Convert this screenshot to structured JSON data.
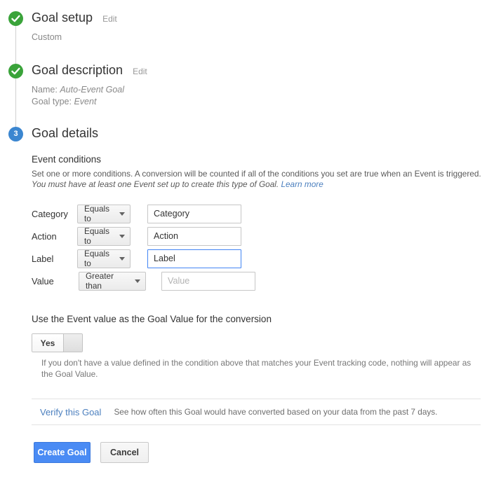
{
  "steps": [
    {
      "marker": "check-icon",
      "state": "done",
      "title": "Goal setup",
      "edit_label": "Edit",
      "summary": "Custom"
    },
    {
      "marker": "check-icon",
      "state": "done",
      "title": "Goal description",
      "edit_label": "Edit",
      "name_label": "Name:",
      "name_value": "Auto-Event Goal",
      "type_label": "Goal type:",
      "type_value": "Event"
    },
    {
      "marker": "3",
      "state": "active",
      "title": "Goal details"
    }
  ],
  "details": {
    "section_title": "Event conditions",
    "desc_line1": "Set one or more conditions. A conversion will be counted if all of the conditions you set are true when an Event is triggered.",
    "desc_line2": "You must have at least one Event set up to create this type of Goal.",
    "learn_more": "Learn more",
    "conditions": [
      {
        "label": "Category",
        "operator": "Equals to",
        "value": "Category",
        "placeholder": "Category",
        "filled": true,
        "focused": false
      },
      {
        "label": "Action",
        "operator": "Equals to",
        "value": "Action",
        "placeholder": "Action",
        "filled": true,
        "focused": false
      },
      {
        "label": "Label",
        "operator": "Equals to",
        "value": "Label",
        "placeholder": "Label",
        "filled": true,
        "focused": true
      },
      {
        "label": "Value",
        "operator": "Greater than",
        "value": "",
        "placeholder": "Value",
        "filled": false,
        "focused": false
      }
    ]
  },
  "goal_value": {
    "title": "Use the Event value as the Goal Value for the conversion",
    "toggle_label": "Yes",
    "toggle_state": "on",
    "note": "If you don't have a value defined in the condition above that matches your Event tracking code, nothing will appear as the Goal Value."
  },
  "verify": {
    "link_label": "Verify this Goal",
    "description": "See how often this Goal would have converted based on your data from the past 7 days."
  },
  "actions": {
    "create_label": "Create Goal",
    "cancel_label": "Cancel"
  },
  "colors": {
    "step_done": "#3aa33a",
    "step_active": "#3b86d0",
    "primary_button": "#4a8bf4",
    "link": "#4b7fbe",
    "focus_border": "#4285f4"
  }
}
